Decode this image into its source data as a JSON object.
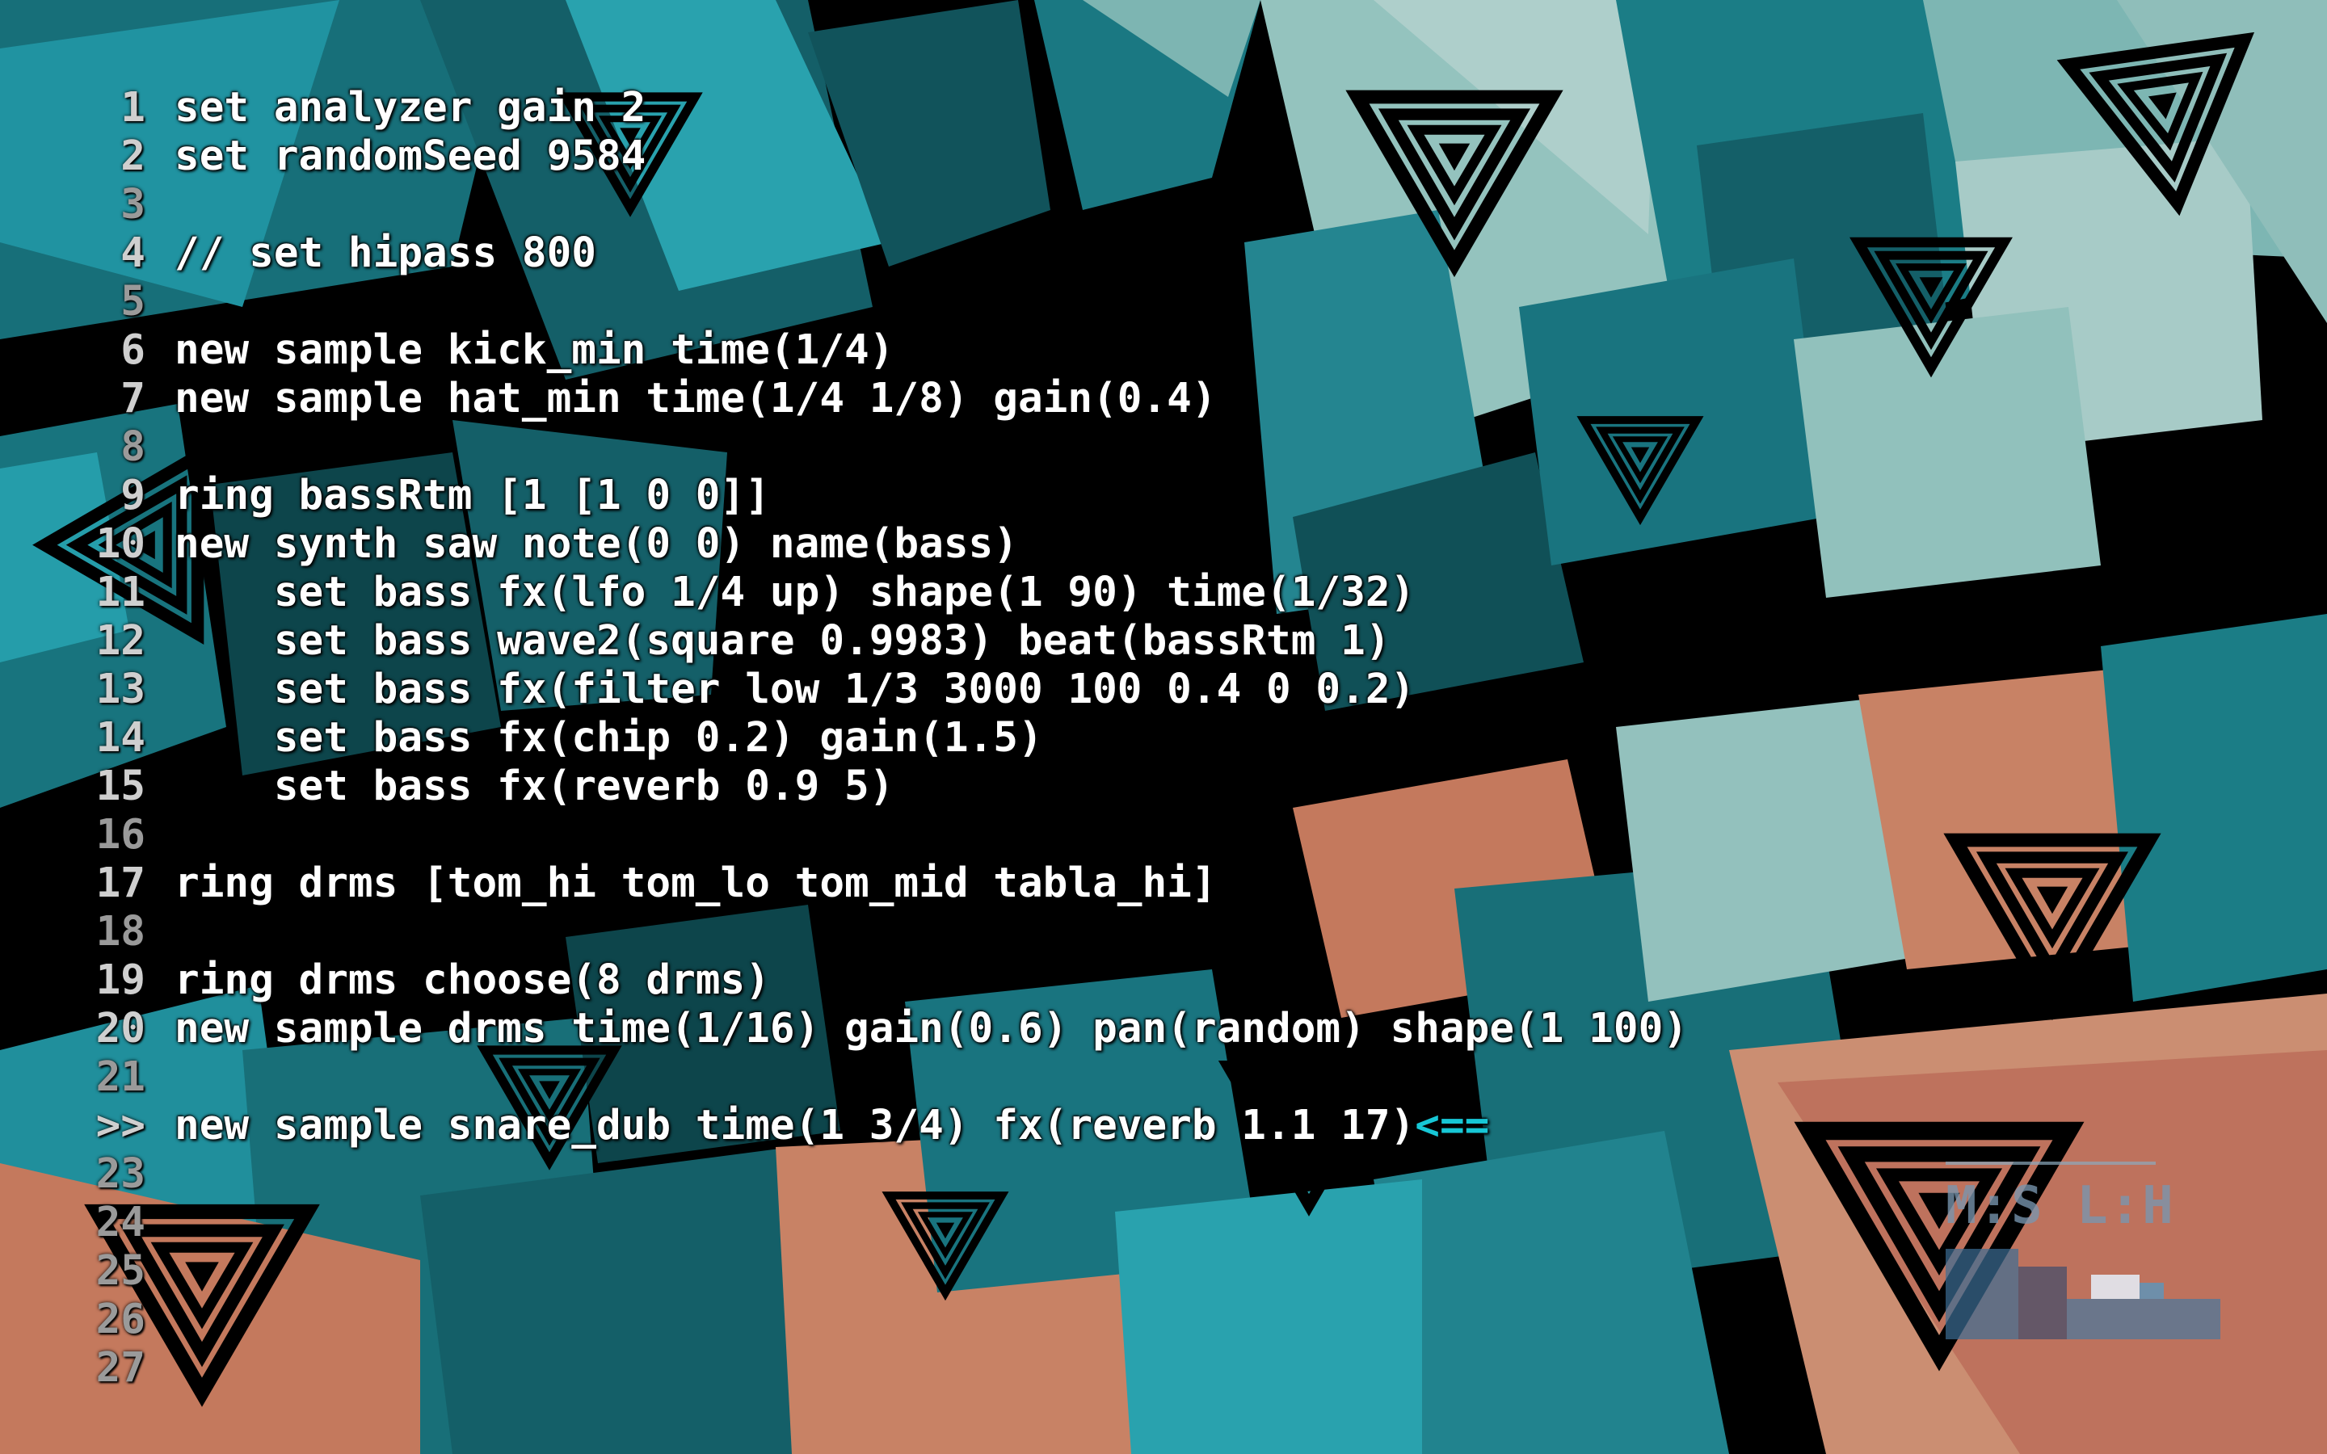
{
  "editor": {
    "lines": [
      {
        "num": "1",
        "code": "set analyzer gain 2"
      },
      {
        "num": "2",
        "code": "set randomSeed 9584"
      },
      {
        "num": "3",
        "code": ""
      },
      {
        "num": "4",
        "code": "// set hipass 800"
      },
      {
        "num": "5",
        "code": ""
      },
      {
        "num": "6",
        "code": "new sample kick_min time(1/4)"
      },
      {
        "num": "7",
        "code": "new sample hat_min time(1/4 1/8) gain(0.4)"
      },
      {
        "num": "8",
        "code": ""
      },
      {
        "num": "9",
        "code": "ring bassRtm [1 [1 0 0]]"
      },
      {
        "num": "10",
        "code": "new synth saw note(0 0) name(bass)"
      },
      {
        "num": "11",
        "code": "    set bass fx(lfo 1/4 up) shape(1 90) time(1/32)"
      },
      {
        "num": "12",
        "code": "    set bass wave2(square 0.9983) beat(bassRtm 1)"
      },
      {
        "num": "13",
        "code": "    set bass fx(filter low 1/3 3000 100 0.4 0 0.2)"
      },
      {
        "num": "14",
        "code": "    set bass fx(chip 0.2) gain(1.5)"
      },
      {
        "num": "15",
        "code": "    set bass fx(reverb 0.9 5)"
      },
      {
        "num": "16",
        "code": ""
      },
      {
        "num": "17",
        "code": "ring drms [tom_hi tom_lo tom_mid tabla_hi]"
      },
      {
        "num": "18",
        "code": ""
      },
      {
        "num": "19",
        "code": "ring drms choose(8 drms)"
      },
      {
        "num": "20",
        "code": "new sample drms time(1/16) gain(0.6) pan(random) shape(1 100)"
      },
      {
        "num": "21",
        "code": ""
      },
      {
        "num": ">>",
        "code": "new sample snare_dub time(1 3/4) fx(reverb 1.1 17)",
        "cursor": "<=="
      },
      {
        "num": "23",
        "code": ""
      },
      {
        "num": "24",
        "code": ""
      },
      {
        "num": "25",
        "code": ""
      },
      {
        "num": "26",
        "code": ""
      },
      {
        "num": "27",
        "code": ""
      }
    ]
  },
  "meter": {
    "label": "M:S L:H"
  },
  "colors": {
    "teal": "#1f8f99",
    "cyan": "#17c7d6",
    "pale": "#a8dcd8",
    "salmon": "#e08a6a",
    "cursor": "#17c7d6"
  }
}
